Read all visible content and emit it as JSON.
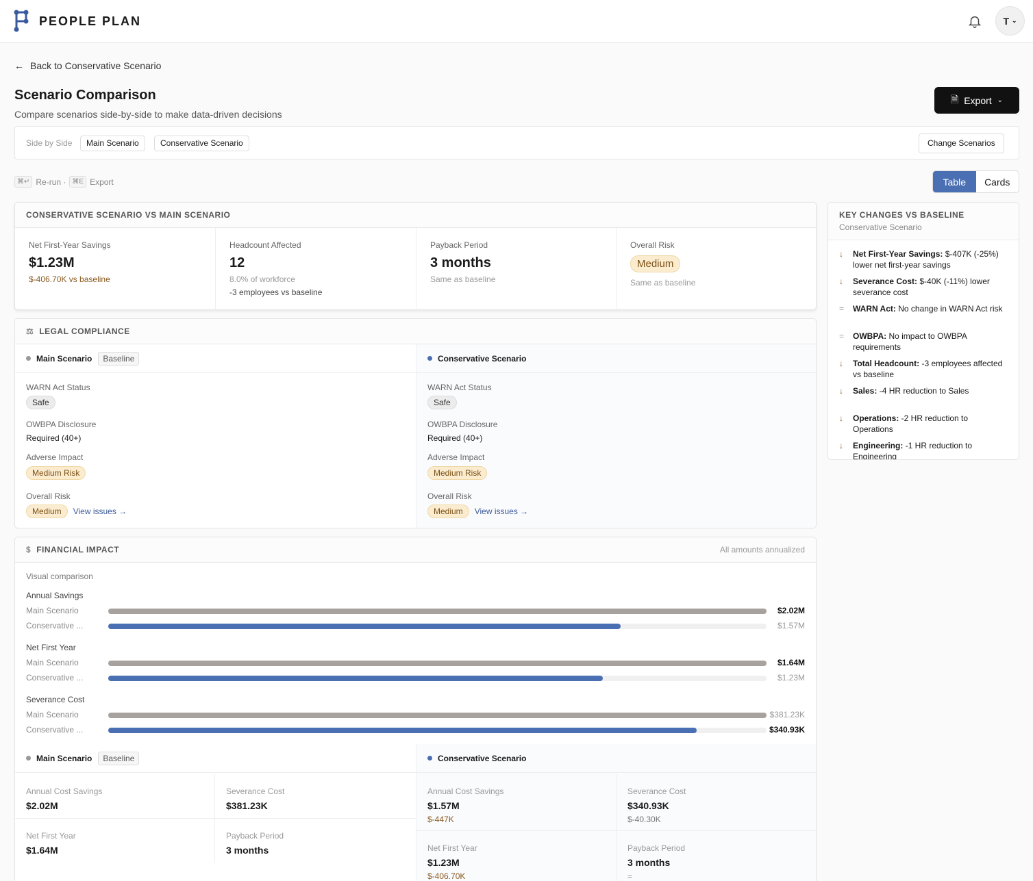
{
  "app": {
    "brand": "PEOPLE PLAN",
    "avatar": "T"
  },
  "nav": {
    "back": "Back to Conservative Scenario"
  },
  "header": {
    "title": "Scenario Comparison",
    "subtitle": "Compare scenarios side-by-side to make data-driven decisions",
    "export": "Export"
  },
  "selector": {
    "mode": "Side by Side",
    "a": "Main Scenario",
    "b": "Conservative Scenario",
    "change": "Change Scenarios"
  },
  "shortcuts": {
    "k1": "⌘↵",
    "l1": "Re-run ·",
    "k2": "⌘E",
    "l2": "Export"
  },
  "view": {
    "table": "Table",
    "cards": "Cards"
  },
  "summary": {
    "title": "CONSERVATIVE SCENARIO VS MAIN SCENARIO",
    "m1": {
      "label": "Net First-Year Savings",
      "value": "$1.23M",
      "delta": "$-406.70K vs baseline"
    },
    "m2": {
      "label": "Headcount Affected",
      "value": "12",
      "pct": "8.0% of workforce",
      "delta": "-3 employees vs baseline"
    },
    "m3": {
      "label": "Payback Period",
      "value": "3 months",
      "delta": "Same as baseline"
    },
    "m4": {
      "label": "Overall Risk",
      "value": "Medium",
      "delta": "Same as baseline"
    }
  },
  "legal": {
    "title": "LEGAL COMPLIANCE",
    "a": {
      "name": "Main Scenario",
      "tag": "Baseline",
      "warn_l": "WARN Act Status",
      "warn": "Safe",
      "owbpa_l": "OWBPA Disclosure",
      "owbpa": "Required (40+)",
      "adv_l": "Adverse Impact",
      "adv": "Medium Risk",
      "risk_l": "Overall Risk",
      "risk": "Medium",
      "link": "View issues →"
    },
    "b": {
      "name": "Conservative Scenario",
      "warn_l": "WARN Act Status",
      "warn": "Safe",
      "owbpa_l": "OWBPA Disclosure",
      "owbpa": "Required (40+)",
      "adv_l": "Adverse Impact",
      "adv": "Medium Risk",
      "risk_l": "Overall Risk",
      "risk": "Medium",
      "link": "View issues →"
    }
  },
  "financial": {
    "title": "FINANCIAL IMPACT",
    "note": "All amounts annualized",
    "visual": "Visual comparison",
    "groups": [
      {
        "label": "Annual Savings",
        "a_name": "Main Scenario",
        "b_name": "Conservative ...",
        "a_val": "$2.02M",
        "b_val": "$1.57M",
        "a": 1.0,
        "b": 0.778
      },
      {
        "label": "Net First Year",
        "a_name": "Main Scenario",
        "b_name": "Conservative ...",
        "a_val": "$1.64M",
        "b_val": "$1.23M",
        "a": 1.0,
        "b": 0.751
      },
      {
        "label": "Severance Cost",
        "a_name": "Main Scenario",
        "b_name": "Conservative ...",
        "a_val": "$381.23K",
        "b_val": "$340.93K",
        "a": 1.0,
        "b": 0.894
      }
    ],
    "a": {
      "name": "Main Scenario",
      "tag": "Baseline",
      "acs_l": "Annual Cost Savings",
      "acs": "$2.02M",
      "sev_l": "Severance Cost",
      "sev": "$381.23K",
      "nfy_l": "Net First Year",
      "nfy": "$1.64M",
      "pp_l": "Payback Period",
      "pp": "3 months"
    },
    "b": {
      "name": "Conservative Scenario",
      "acs_l": "Annual Cost Savings",
      "acs": "$1.57M",
      "acs_d": "$-447K",
      "sev_l": "Severance Cost",
      "sev": "$340.93K",
      "sev_d": "$-40.30K",
      "nfy_l": "Net First Year",
      "nfy": "$1.23M",
      "nfy_d": "$-406.70K",
      "pp_l": "Payback Period",
      "pp": "3 months",
      "pp_d": "="
    }
  },
  "key": {
    "title": "KEY CHANGES VS BASELINE",
    "sub": "Conservative Scenario",
    "items": [
      {
        "icon": "↓",
        "b": "Net First-Year Savings:",
        "t": " $-407K (-25%) lower net first-year savings"
      },
      {
        "icon": "↓",
        "b": "Severance Cost:",
        "t": " $-40K (-11%) lower severance cost"
      },
      {
        "icon": "=",
        "b": "WARN Act:",
        "t": " No change in WARN Act risk"
      },
      {
        "icon": "=",
        "b": "OWBPA:",
        "t": " No impact to OWBPA requirements"
      },
      {
        "icon": "↓",
        "b": "Total Headcount:",
        "t": " -3 employees affected vs baseline"
      },
      {
        "icon": "↓",
        "b": "Sales:",
        "t": " -4 HR reduction to Sales"
      },
      {
        "icon": "↓",
        "b": "Operations:",
        "t": " -2 HR reduction to Operations"
      },
      {
        "icon": "↓",
        "b": "Engineering:",
        "t": " -1 HR reduction to Engineering"
      }
    ]
  },
  "colors": {
    "accent": "#4a6fb3",
    "baseline": "#a8a29e"
  }
}
